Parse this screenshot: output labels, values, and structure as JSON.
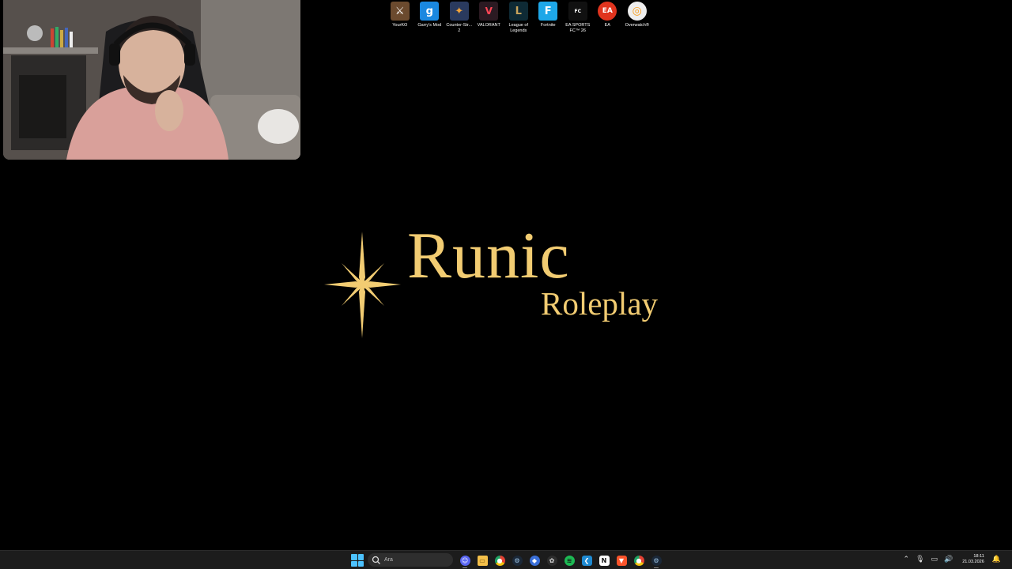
{
  "desktop_icons": [
    {
      "label": "YourKO",
      "icon": "yourko-icon",
      "color": "#6b4a2e"
    },
    {
      "label": "Garry's Mod",
      "icon": "garrys-mod-icon",
      "color": "#1a88e0"
    },
    {
      "label": "Counter-Str... 2",
      "icon": "counter-strike-2-icon",
      "color": "#2a3a5e"
    },
    {
      "label": "VALORANT",
      "icon": "valorant-icon",
      "color": "#2b1a22"
    },
    {
      "label": "League of Legends",
      "icon": "league-of-legends-icon",
      "color": "#0e2a35"
    },
    {
      "label": "Fortnite",
      "icon": "fortnite-icon",
      "color": "#1ea7e8"
    },
    {
      "label": "EA SPORTS FC™ 26",
      "icon": "ea-sports-fc-icon",
      "color": "#111111"
    },
    {
      "label": "EA",
      "icon": "ea-icon",
      "color": "#e0341e"
    },
    {
      "label": "Overwatch®",
      "icon": "overwatch-icon",
      "color": "#eeeeee"
    }
  ],
  "logo": {
    "title": "Runic",
    "subtitle": "Roleplay",
    "color": "#f2cc72"
  },
  "taskbar": {
    "search_placeholder": "Ara",
    "apps": [
      {
        "icon": "discord-icon",
        "color": "#5865f2",
        "running": true
      },
      {
        "icon": "file-explorer-icon",
        "color": "#f5c04a",
        "running": false
      },
      {
        "icon": "chrome-icon",
        "color": "#e34133",
        "running": false
      },
      {
        "icon": "steam-icon",
        "color": "#1b2838",
        "running": false
      },
      {
        "icon": "settings-app-icon",
        "color": "#3a6fd8",
        "running": false
      },
      {
        "icon": "chatgpt-icon",
        "color": "#2d2d2d",
        "running": false
      },
      {
        "icon": "spotify-icon",
        "color": "#1db954",
        "running": false
      },
      {
        "icon": "vscode-icon",
        "color": "#1f8ad2",
        "running": false
      },
      {
        "icon": "notion-icon",
        "color": "#ffffff",
        "running": false
      },
      {
        "icon": "brave-icon",
        "color": "#fb542b",
        "running": false
      },
      {
        "icon": "chrome-profile-icon",
        "color": "#e34133",
        "running": false
      },
      {
        "icon": "steam-running-icon",
        "color": "#1b2838",
        "running": true
      }
    ],
    "time": "18:11",
    "date": "21.03.2026"
  }
}
